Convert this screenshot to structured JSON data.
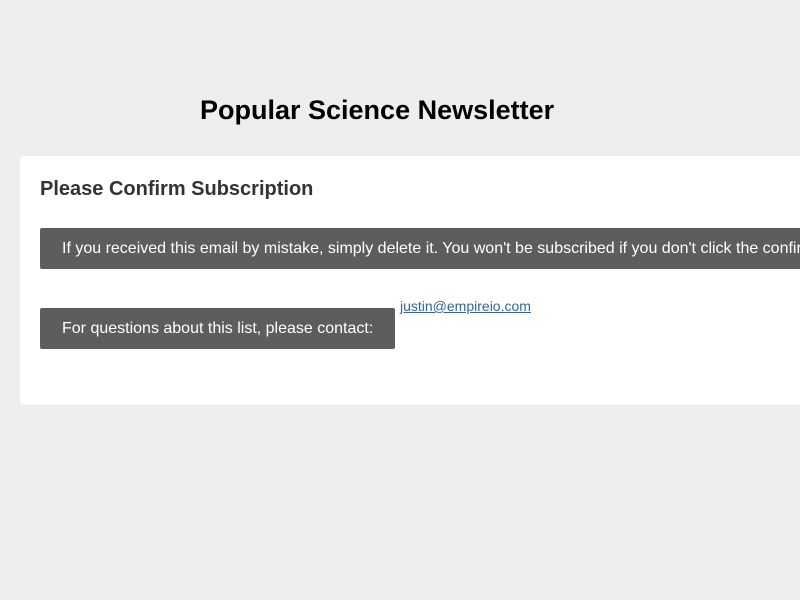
{
  "page": {
    "title": "Popular Science Newsletter"
  },
  "card": {
    "heading": "Please Confirm Subscription",
    "notice_text": "If you received this email by mistake, simply delete it. You won't be subscribed if you don't click the confirmation link above.",
    "contact_label": "For questions about this list, please contact:",
    "contact_email": "justin@empireio.com"
  },
  "colors": {
    "background": "#eeeeee",
    "card": "#ffffff",
    "bar": "#5d5d5d",
    "link": "#336699"
  }
}
